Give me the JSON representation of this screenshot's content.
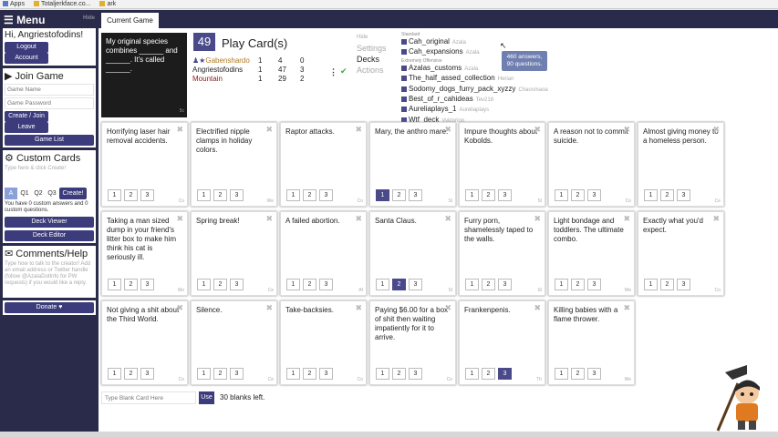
{
  "bookmarks": [
    "Apps",
    "Totaljerkface.co...",
    "ark"
  ],
  "sidebar": {
    "menu_title": "Menu",
    "hide_label": "Hide",
    "greeting": "Hi, Angriestofodins!",
    "logout": "Logout",
    "account": "Account",
    "join_title": "Join Game",
    "game_name_ph": "Game Name",
    "game_password_ph": "Game Password",
    "create_join": "Create / Join",
    "leave": "Leave",
    "game_list": "Game List",
    "custom_title": "Custom Cards",
    "custom_ph": "Type here & click Create!",
    "qtabs": [
      "A",
      "Q1",
      "Q2",
      "Q3"
    ],
    "create": "Create!",
    "custom_note": "You have 0 custom answers and 0 custom questions.",
    "deck_viewer": "Deck Viewer",
    "deck_editor": "Deck Editor",
    "comments_title": "Comments/Help",
    "comments_ph": "Type how to talk to the creator! Add an email address or Twitter handle (follow @AzalaDotInfo for PW requests) if you would like a reply.",
    "donate": "Donate"
  },
  "tab": "Current Game",
  "black_card": {
    "text": "My original species combines ______ and ______. It's called ______.",
    "label": "5c"
  },
  "play_count": "49",
  "play_title": "Play Card(s)",
  "scores": [
    {
      "name": "Gabenshardo",
      "a": "1",
      "b": "4",
      "c": "0"
    },
    {
      "name": "Angriestofodins",
      "a": "1",
      "b": "47",
      "c": "3"
    },
    {
      "name": "Mountain",
      "a": "1",
      "b": "29",
      "c": "2"
    }
  ],
  "vmenu": {
    "hide": "Hide",
    "settings": "Settings",
    "decks": "Decks",
    "actions": "Actions"
  },
  "decks": {
    "standard_label": "Standard",
    "standard": [
      {
        "name": "Cah_original",
        "author": "Azala"
      },
      {
        "name": "Cah_expansions",
        "author": "Azala"
      }
    ],
    "offensive_label": "Extremely Offensive",
    "offensive": [
      {
        "name": "Azalas_customs",
        "author": "Azala"
      },
      {
        "name": "The_half_assed_collection",
        "author": "Herian"
      },
      {
        "name": "Sodomy_dogs_furry_pack_xyzzy",
        "author": "Chaosmaoa"
      },
      {
        "name": "Best_of_r_cahideas",
        "author": "Tev216"
      },
      {
        "name": "Aureliaplays_1",
        "author": "Aureliaplays"
      },
      {
        "name": "Wtf_deck",
        "author": "Vyktorion"
      }
    ]
  },
  "tooltip": "460 answers, 90 questions.",
  "cards": [
    {
      "text": "Horrifying laser hair removal accidents.",
      "label": "Co",
      "sel": 0
    },
    {
      "text": "Electrified nipple clamps in holiday colors.",
      "label": "We",
      "sel": 0
    },
    {
      "text": "Raptor attacks.",
      "label": "Co",
      "sel": 0
    },
    {
      "text": "Mary, the anthro mare.",
      "label": "Sl",
      "sel": 1
    },
    {
      "text": "Impure thoughts about Kobolds.",
      "label": "Sl",
      "sel": 0
    },
    {
      "text": "A reason not to commit suicide.",
      "label": "Co",
      "sel": 0
    },
    {
      "text": "Almost giving money to a homeless person.",
      "label": "Ce",
      "sel": 0
    },
    {
      "text": "Taking a man sized dump in your friend's litter box to make him think his cat is seriously ill.",
      "label": "Mo",
      "sel": 0
    },
    {
      "text": "Spring break!",
      "label": "Ce",
      "sel": 0
    },
    {
      "text": "A failed abortion.",
      "label": "Af",
      "sel": 0
    },
    {
      "text": "Santa Claus.",
      "label": "Sl",
      "sel": 2
    },
    {
      "text": "Furry porn, shamelessly taped to the walls.",
      "label": "Sl",
      "sel": 0
    },
    {
      "text": "Light bondage and toddlers. The ultimate combo.",
      "label": "We",
      "sel": 0
    },
    {
      "text": "Exactly what you'd expect.",
      "label": "Co",
      "sel": 0
    },
    {
      "text": "Not giving a shit about the Third World.",
      "label": "Co",
      "sel": 0
    },
    {
      "text": "Silence.",
      "label": "Ce",
      "sel": 0
    },
    {
      "text": "Take-backsies.",
      "label": "Co",
      "sel": 0
    },
    {
      "text": "Paying $6.00 for a box of shit then waiting impatiently for it to arrive.",
      "label": "Co",
      "sel": 0
    },
    {
      "text": "Frankenpenis.",
      "label": "Th",
      "sel": 3
    },
    {
      "text": "Killing babies with a flame thrower.",
      "label": "We",
      "sel": 0
    }
  ],
  "blank_ph": "Type Blank Card Here",
  "use": "Use",
  "blanks_left": "30 blanks left."
}
